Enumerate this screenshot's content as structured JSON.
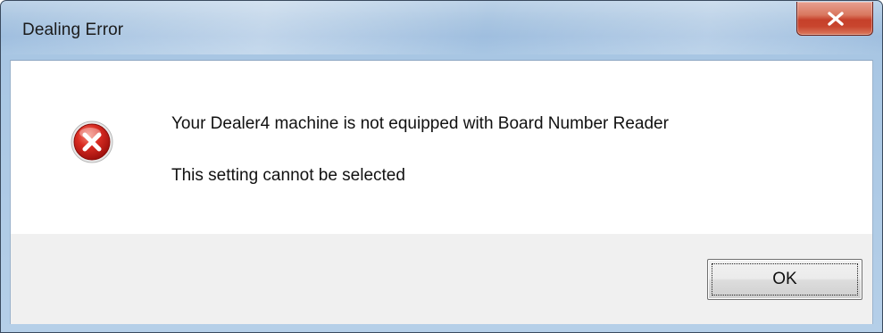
{
  "window": {
    "title": "Dealing Error"
  },
  "titlebar": {
    "close_icon": "close-icon"
  },
  "message": {
    "icon": "error-icon",
    "line1": "Your Dealer4 machine is not equipped with Board Number Reader",
    "line2": "This setting cannot be selected"
  },
  "buttons": {
    "ok_label": "OK"
  },
  "colors": {
    "close_button": "#c6402a",
    "error_icon": "#c81e1e",
    "frame": "#a9c5e1"
  }
}
